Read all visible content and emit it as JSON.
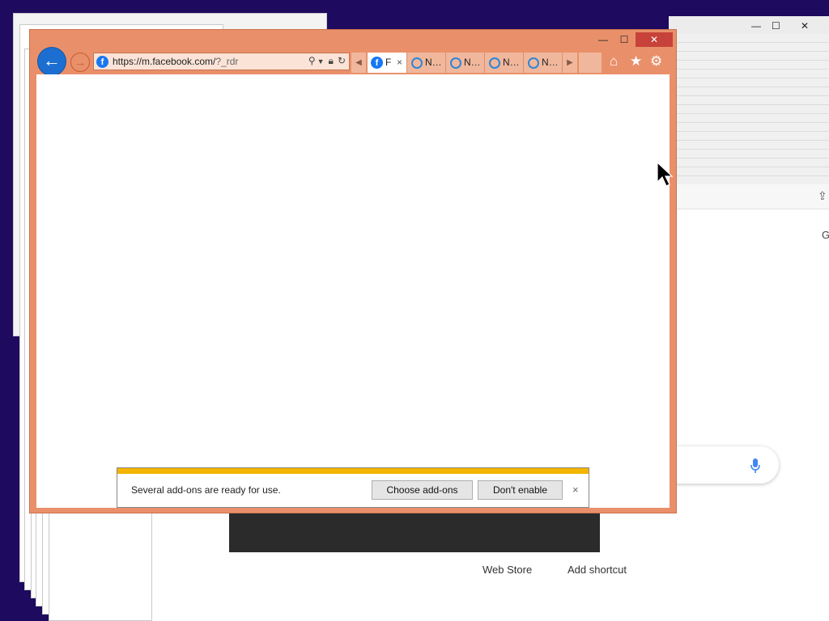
{
  "browser": {
    "address_url": "https://m.facebook.com/",
    "address_url_suffix": "?_rdr",
    "tabs": [
      {
        "label": "F",
        "icon": "facebook-icon",
        "active": true,
        "close": "×"
      },
      {
        "label": "N…",
        "icon": "ie-icon"
      },
      {
        "label": "N…",
        "icon": "ie-icon"
      },
      {
        "label": "N…",
        "icon": "ie-icon"
      },
      {
        "label": "N…",
        "icon": "ie-icon"
      }
    ],
    "caption": {
      "minimize": "—",
      "maximize": "☐",
      "close": "✕"
    },
    "accent": "#e9906a"
  },
  "notification": {
    "message": "Several add-ons are ready for use.",
    "choose_label": "Choose add-ons",
    "dont_enable_label": "Don't enable",
    "close": "×",
    "stripe_color": "#f3b500"
  },
  "background_window": {
    "shortcuts": [
      "Web Store",
      "Add shortcut"
    ],
    "partial_text": "G",
    "caption": {
      "minimize": "—",
      "maximize": "☐",
      "close": "✕"
    }
  }
}
